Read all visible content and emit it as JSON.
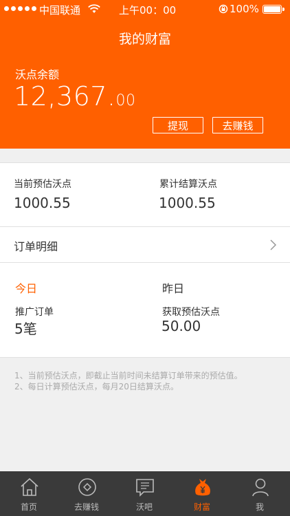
{
  "status_bar": {
    "carrier": "中国联通",
    "time": "上午00：00",
    "battery": "100%"
  },
  "header": {
    "title": "我的财富",
    "balance_label": "沃点余额",
    "balance_int": "12,367.",
    "balance_dec": "00",
    "withdraw_button": "提现",
    "earn_button": "去赚钱"
  },
  "stats": {
    "current_estimated_label": "当前预估沃点",
    "current_estimated_value": "1000.55",
    "cumulative_settled_label": "累计结算沃点",
    "cumulative_settled_value": "1000.55"
  },
  "orders": {
    "label": "订单明细"
  },
  "daily": {
    "today_tab": "今日",
    "yesterday_tab": "昨日",
    "orders_label": "推广订单",
    "orders_value": "5笔",
    "earned_label": "获取预估沃点",
    "earned_value": "50.00"
  },
  "notes": [
    "1、当前预估沃点，即截止当前时间未结算订单带来的预估值。",
    "2、每日计算预估沃点，每月20日结算沃点。"
  ],
  "tabbar": {
    "items": [
      {
        "label": "首页",
        "icon": "home-icon"
      },
      {
        "label": "去赚钱",
        "icon": "coin-icon"
      },
      {
        "label": "沃吧",
        "icon": "chat-icon"
      },
      {
        "label": "财富",
        "icon": "money-bag-icon"
      },
      {
        "label": "我",
        "icon": "user-icon"
      }
    ],
    "active_index": 3
  },
  "colors": {
    "accent": "#ff6000",
    "tabbar_bg": "#3a3a3a"
  }
}
